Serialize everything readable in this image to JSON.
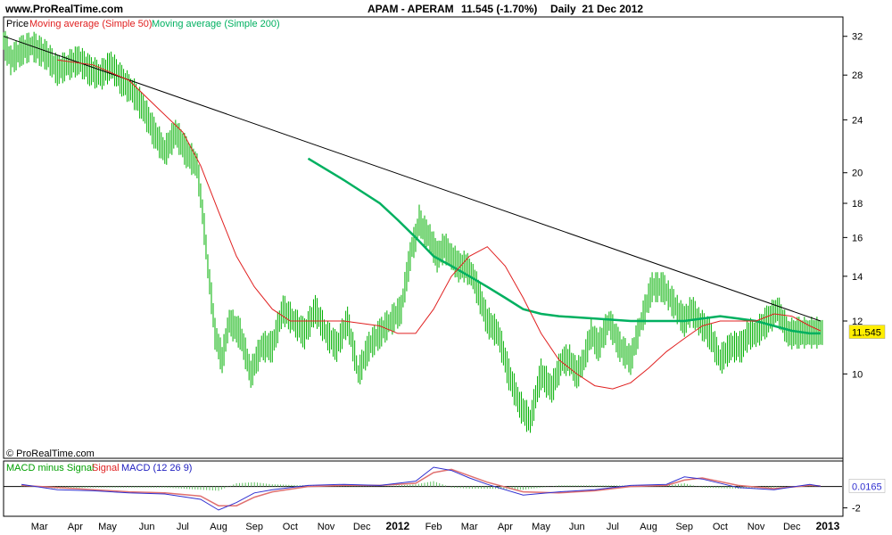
{
  "header": {
    "site": "www.ProRealTime.com",
    "symbol": "APAM - APERAM",
    "price_change": "11.545 (-1.70%)",
    "period_date": "Daily  21 Dec 2012"
  },
  "legend": {
    "price": "Price",
    "ma50": "Moving average (Simple 50)",
    "ma200": "Moving average (Simple 200)"
  },
  "copyright": "© ProRealTime.com",
  "macd_legend": {
    "hist": "MACD minus Signal",
    "signal": "Signal",
    "macd": "MACD (12 26 9)"
  },
  "colors": {
    "price_bars": "#00b000",
    "ma50": "#e02020",
    "ma200": "#00b060",
    "trendline": "#000000",
    "macd": "#3030d0",
    "signal": "#e07070",
    "hist": "#60c060",
    "last_price_bg": "#ffee00"
  },
  "chart_data": [
    {
      "type": "line",
      "panel": "price",
      "yscale": "log",
      "ylim": [
        7.5,
        34
      ],
      "y_ticks": [
        10,
        12,
        14,
        16,
        18,
        20,
        24,
        28,
        32
      ],
      "x_labels": [
        "Mar",
        "Apr",
        "May",
        "Jun",
        "Jul",
        "Aug",
        "Sep",
        "Oct",
        "Nov",
        "Dec",
        "2012",
        "Feb",
        "Mar",
        "Apr",
        "May",
        "Jun",
        "Jul",
        "Aug",
        "Sep",
        "Oct",
        "Nov",
        "Dec",
        "2013"
      ],
      "x_label_time": [
        0.5,
        1.5,
        2.4,
        3.5,
        4.5,
        5.5,
        6.5,
        7.5,
        8.5,
        9.5,
        10.5,
        11.5,
        12.5,
        13.5,
        14.5,
        15.5,
        16.5,
        17.5,
        18.5,
        19.5,
        20.5,
        21.5,
        22.5
      ],
      "xlim": [
        -0.5,
        22.9
      ],
      "last_price": "11.545",
      "series": [
        {
          "name": "Price",
          "style": "ohlc-bars",
          "time": [
            -0.5,
            -0.3,
            0.0,
            0.3,
            0.7,
            1.0,
            1.3,
            1.6,
            1.9,
            2.2,
            2.5,
            2.8,
            3.1,
            3.4,
            3.7,
            4.0,
            4.3,
            4.6,
            4.9,
            5.2,
            5.4,
            5.6,
            5.8,
            6.1,
            6.4,
            6.7,
            7.0,
            7.3,
            7.6,
            7.9,
            8.2,
            8.5,
            8.8,
            9.1,
            9.4,
            9.7,
            10.0,
            10.3,
            10.6,
            10.8,
            10.9,
            11.0,
            11.1,
            11.2,
            11.4,
            11.6,
            11.8,
            12.0,
            12.2,
            12.4,
            12.6,
            12.8,
            13.0,
            13.3,
            13.6,
            13.9,
            14.2,
            14.5,
            14.8,
            15.1,
            15.3,
            15.5,
            15.7,
            15.9,
            16.1,
            16.4,
            16.7,
            17.0,
            17.3,
            17.6,
            17.9,
            18.1,
            18.3,
            18.5,
            18.7,
            18.9,
            19.2,
            19.5,
            19.8,
            20.1,
            20.3,
            20.5,
            20.8,
            21.1,
            21.4,
            21.7,
            22.0,
            22.3
          ],
          "close": [
            31.5,
            29.5,
            30.5,
            31.0,
            30.0,
            28.5,
            29.0,
            29.5,
            28.5,
            28.0,
            29.0,
            27.5,
            26.5,
            25.0,
            23.0,
            21.5,
            23.0,
            21.5,
            20.5,
            14.5,
            11.5,
            10.5,
            12.0,
            11.5,
            10.0,
            11.0,
            11.0,
            12.5,
            12.0,
            11.5,
            12.5,
            11.5,
            11.0,
            12.0,
            10.0,
            11.0,
            11.5,
            12.0,
            12.5,
            14.5,
            15.5,
            16.0,
            17.0,
            16.5,
            16.0,
            15.0,
            15.5,
            15.0,
            14.5,
            14.5,
            14.0,
            13.0,
            12.0,
            11.5,
            10.0,
            9.0,
            8.5,
            10.0,
            9.5,
            10.5,
            10.5,
            10.0,
            10.5,
            11.5,
            11.0,
            12.0,
            11.0,
            10.5,
            12.0,
            13.5,
            13.5,
            13.0,
            12.5,
            12.0,
            12.5,
            12.0,
            11.5,
            10.5,
            11.0,
            11.0,
            11.5,
            11.5,
            12.0,
            12.5,
            11.5,
            11.545,
            11.545,
            11.545
          ]
        },
        {
          "name": "Moving average (Simple 50)",
          "style": "line",
          "time": [
            1.0,
            2.0,
            3.0,
            3.8,
            4.5,
            5.0,
            5.5,
            6.0,
            6.5,
            7.0,
            7.5,
            8.0,
            9.0,
            10.0,
            10.5,
            11.0,
            11.5,
            12.0,
            12.5,
            13.0,
            13.5,
            14.0,
            14.5,
            15.0,
            15.5,
            16.0,
            16.5,
            17.0,
            17.5,
            18.0,
            18.5,
            19.0,
            19.5,
            20.0,
            20.5,
            21.0,
            21.5,
            22.0,
            22.3
          ],
          "values": [
            29.5,
            29.0,
            27.5,
            25.0,
            23.0,
            20.5,
            17.5,
            15.0,
            13.5,
            12.5,
            12.0,
            12.0,
            12.0,
            11.8,
            11.5,
            11.5,
            12.5,
            14.0,
            15.0,
            15.5,
            14.5,
            13.0,
            11.5,
            10.5,
            10.0,
            9.6,
            9.5,
            9.7,
            10.2,
            10.8,
            11.3,
            11.8,
            12.0,
            12.0,
            12.0,
            12.3,
            12.2,
            11.8,
            11.6
          ]
        },
        {
          "name": "Moving average (Simple 200)",
          "style": "line",
          "time": [
            8.0,
            9.0,
            10.0,
            10.5,
            11.0,
            11.5,
            12.0,
            12.5,
            13.0,
            13.5,
            14.0,
            14.5,
            15.0,
            16.0,
            17.0,
            18.0,
            18.5,
            19.0,
            19.5,
            20.0,
            20.5,
            21.0,
            21.5,
            22.0,
            22.3
          ],
          "values": [
            21.0,
            19.5,
            18.0,
            17.0,
            16.0,
            15.0,
            14.5,
            14.0,
            13.5,
            13.0,
            12.5,
            12.3,
            12.2,
            12.1,
            12.0,
            12.0,
            12.0,
            12.1,
            12.2,
            12.1,
            12.0,
            11.8,
            11.6,
            11.5,
            11.5
          ]
        },
        {
          "name": "Trendline",
          "style": "line",
          "time": [
            -0.5,
            22.3
          ],
          "values": [
            32.0,
            12.0
          ]
        }
      ]
    },
    {
      "type": "line",
      "panel": "macd",
      "ylim": [
        -2.7,
        2.3
      ],
      "y_ticks": [
        -2
      ],
      "last_value": "0.0165",
      "series": [
        {
          "name": "MACD (12 26 9)",
          "time": [
            0,
            1,
            2,
            3,
            4,
            5,
            5.5,
            6,
            6.5,
            7,
            8,
            9,
            10,
            11,
            11.5,
            12,
            12.5,
            13,
            14,
            15,
            16,
            17,
            18,
            18.5,
            19,
            20,
            21,
            22,
            22.3
          ],
          "values": [
            0.2,
            -0.3,
            -0.4,
            -0.6,
            -0.7,
            -1.2,
            -2.2,
            -1.5,
            -0.6,
            -0.3,
            0.1,
            0.2,
            0.1,
            0.5,
            1.8,
            1.5,
            0.8,
            0.2,
            -0.8,
            -0.5,
            -0.3,
            0.1,
            0.2,
            0.9,
            0.7,
            -0.1,
            -0.3,
            0.2,
            0.0165
          ]
        },
        {
          "name": "Signal",
          "time": [
            0,
            1,
            2,
            3,
            4,
            5,
            5.5,
            6,
            6.5,
            7,
            8,
            9,
            10,
            11,
            11.5,
            12,
            12.5,
            13,
            14,
            15,
            16,
            17,
            18,
            18.5,
            19,
            20,
            21,
            22,
            22.3
          ],
          "values": [
            0.1,
            -0.1,
            -0.3,
            -0.5,
            -0.6,
            -0.9,
            -1.8,
            -1.8,
            -1.0,
            -0.5,
            0.0,
            0.1,
            0.1,
            0.3,
            1.3,
            1.6,
            1.0,
            0.4,
            -0.5,
            -0.6,
            -0.4,
            0.0,
            0.1,
            0.6,
            0.8,
            0.1,
            -0.2,
            0.1,
            0.05
          ]
        },
        {
          "name": "MACD minus Signal",
          "style": "histogram",
          "time": [
            0,
            1,
            2,
            3,
            4,
            5,
            5.5,
            6,
            6.5,
            7,
            8,
            9,
            10,
            11,
            11.5,
            12,
            12.5,
            13,
            14,
            15,
            16,
            17,
            18,
            18.5,
            19,
            20,
            21,
            22,
            22.3
          ],
          "values": [
            0.1,
            -0.2,
            -0.1,
            -0.1,
            -0.1,
            -0.3,
            -0.4,
            0.3,
            0.4,
            0.2,
            0.1,
            0.1,
            0.0,
            0.2,
            0.5,
            -0.1,
            -0.2,
            -0.2,
            -0.3,
            0.1,
            0.1,
            0.1,
            0.1,
            0.3,
            -0.1,
            -0.2,
            -0.1,
            0.1,
            -0.03
          ]
        }
      ]
    }
  ]
}
